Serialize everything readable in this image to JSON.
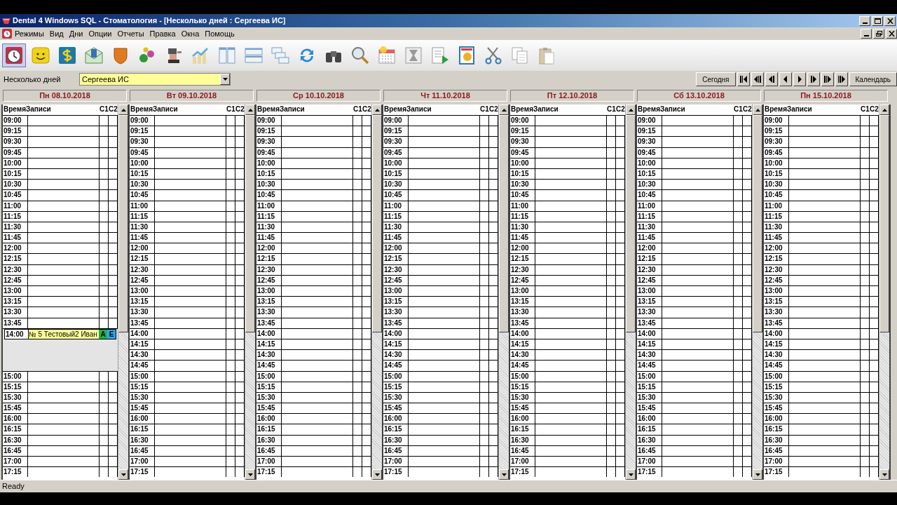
{
  "window": {
    "title": "Dental 4 Windows SQL - Стоматология - [Несколько дней : Сергеева ИС]"
  },
  "menu": [
    "Режимы",
    "Вид",
    "Дни",
    "Опции",
    "Отчеты",
    "Правка",
    "Окна",
    "Помощь"
  ],
  "toolbar": [
    {
      "selected": true
    },
    {
      "selected": false
    },
    {
      "selected": false
    },
    {
      "selected": false
    },
    {
      "selected": false
    },
    {
      "selected": false
    },
    {
      "selected": false
    },
    {
      "selected": false
    },
    {
      "selected": false
    },
    {
      "selected": false
    },
    {
      "selected": false
    },
    {
      "selected": false
    },
    {
      "selected": false
    },
    {
      "selected": false
    },
    {
      "selected": false
    },
    {
      "selected": false
    },
    {
      "selected": false
    },
    {
      "selected": false
    },
    {
      "selected": false
    },
    {
      "selected": false
    },
    {
      "selected": false
    }
  ],
  "filter": {
    "label": "Несколько дней",
    "doctor": "Сергеева ИС",
    "today_button": "Сегодня",
    "calendar_button": "Календарь"
  },
  "days": [
    {
      "title": "Пн 08.10.2018",
      "columns": [
        "ВремяЗаписи",
        "С1",
        "С2"
      ],
      "slots": [
        {
          "kind": "slot",
          "time": "09:00"
        },
        {
          "kind": "slot",
          "time": "09:15"
        },
        {
          "kind": "slot",
          "time": "09:30"
        },
        {
          "kind": "slot",
          "time": "09:45"
        },
        {
          "kind": "slot",
          "time": "10:00"
        },
        {
          "kind": "slot",
          "time": "10:15"
        },
        {
          "kind": "slot",
          "time": "10:30"
        },
        {
          "kind": "slot",
          "time": "10:45"
        },
        {
          "kind": "slot",
          "time": "11:00"
        },
        {
          "kind": "slot",
          "time": "11:15"
        },
        {
          "kind": "slot",
          "time": "11:30"
        },
        {
          "kind": "slot",
          "time": "11:45"
        },
        {
          "kind": "slot",
          "time": "12:00"
        },
        {
          "kind": "slot",
          "time": "12:15"
        },
        {
          "kind": "slot",
          "time": "12:30"
        },
        {
          "kind": "slot",
          "time": "12:45"
        },
        {
          "kind": "slot",
          "time": "13:00"
        },
        {
          "kind": "slot",
          "time": "13:15"
        },
        {
          "kind": "slot",
          "time": "13:30"
        },
        {
          "kind": "slot",
          "time": "13:45"
        },
        {
          "kind": "appointment",
          "time": "14:00",
          "text": "№ 5  Тестовый2 Иван",
          "marks": [
            {
              "text": "А",
              "color": "#22b04c"
            },
            {
              "text": "Е",
              "color": "#2aa8f0"
            }
          ]
        },
        {
          "kind": "slot",
          "time": "15:00"
        },
        {
          "kind": "slot",
          "time": "15:15"
        },
        {
          "kind": "slot",
          "time": "15:30"
        },
        {
          "kind": "slot",
          "time": "15:45"
        },
        {
          "kind": "slot",
          "time": "16:00"
        },
        {
          "kind": "slot",
          "time": "16:15"
        },
        {
          "kind": "slot",
          "time": "16:30"
        },
        {
          "kind": "slot",
          "time": "16:45"
        },
        {
          "kind": "slot",
          "time": "17:00"
        },
        {
          "kind": "slot",
          "time": "17:15"
        }
      ]
    },
    {
      "title": "Вт 09.10.2018",
      "columns": [
        "ВремяЗаписи",
        "С1",
        "С2"
      ],
      "slots": [
        {
          "kind": "slot",
          "time": "09:00"
        },
        {
          "kind": "slot",
          "time": "09:15"
        },
        {
          "kind": "slot",
          "time": "09:30"
        },
        {
          "kind": "slot",
          "time": "09:45"
        },
        {
          "kind": "slot",
          "time": "10:00"
        },
        {
          "kind": "slot",
          "time": "10:15"
        },
        {
          "kind": "slot",
          "time": "10:30"
        },
        {
          "kind": "slot",
          "time": "10:45"
        },
        {
          "kind": "slot",
          "time": "11:00"
        },
        {
          "kind": "slot",
          "time": "11:15"
        },
        {
          "kind": "slot",
          "time": "11:30"
        },
        {
          "kind": "slot",
          "time": "11:45"
        },
        {
          "kind": "slot",
          "time": "12:00"
        },
        {
          "kind": "slot",
          "time": "12:15"
        },
        {
          "kind": "slot",
          "time": "12:30"
        },
        {
          "kind": "slot",
          "time": "12:45"
        },
        {
          "kind": "slot",
          "time": "13:00"
        },
        {
          "kind": "slot",
          "time": "13:15"
        },
        {
          "kind": "slot",
          "time": "13:30"
        },
        {
          "kind": "slot",
          "time": "13:45"
        },
        {
          "kind": "slot",
          "time": "14:00"
        },
        {
          "kind": "slot",
          "time": "14:15"
        },
        {
          "kind": "slot",
          "time": "14:30"
        },
        {
          "kind": "slot",
          "time": "14:45"
        },
        {
          "kind": "slot",
          "time": "15:00"
        },
        {
          "kind": "slot",
          "time": "15:15"
        },
        {
          "kind": "slot",
          "time": "15:30"
        },
        {
          "kind": "slot",
          "time": "15:45"
        },
        {
          "kind": "slot",
          "time": "16:00"
        },
        {
          "kind": "slot",
          "time": "16:15"
        },
        {
          "kind": "slot",
          "time": "16:30"
        },
        {
          "kind": "slot",
          "time": "16:45"
        },
        {
          "kind": "slot",
          "time": "17:00"
        },
        {
          "kind": "slot",
          "time": "17:15"
        }
      ]
    },
    {
      "title": "Ср 10.10.2018",
      "columns": [
        "ВремяЗаписи",
        "С1",
        "С2"
      ],
      "slots": [
        {
          "kind": "slot",
          "time": "09:00"
        },
        {
          "kind": "slot",
          "time": "09:15"
        },
        {
          "kind": "slot",
          "time": "09:30"
        },
        {
          "kind": "slot",
          "time": "09:45"
        },
        {
          "kind": "slot",
          "time": "10:00"
        },
        {
          "kind": "slot",
          "time": "10:15"
        },
        {
          "kind": "slot",
          "time": "10:30"
        },
        {
          "kind": "slot",
          "time": "10:45"
        },
        {
          "kind": "slot",
          "time": "11:00"
        },
        {
          "kind": "slot",
          "time": "11:15"
        },
        {
          "kind": "slot",
          "time": "11:30"
        },
        {
          "kind": "slot",
          "time": "11:45"
        },
        {
          "kind": "slot",
          "time": "12:00"
        },
        {
          "kind": "slot",
          "time": "12:15"
        },
        {
          "kind": "slot",
          "time": "12:30"
        },
        {
          "kind": "slot",
          "time": "12:45"
        },
        {
          "kind": "slot",
          "time": "13:00"
        },
        {
          "kind": "slot",
          "time": "13:15"
        },
        {
          "kind": "slot",
          "time": "13:30"
        },
        {
          "kind": "slot",
          "time": "13:45"
        },
        {
          "kind": "slot",
          "time": "14:00"
        },
        {
          "kind": "slot",
          "time": "14:15"
        },
        {
          "kind": "slot",
          "time": "14:30"
        },
        {
          "kind": "slot",
          "time": "14:45"
        },
        {
          "kind": "slot",
          "time": "15:00"
        },
        {
          "kind": "slot",
          "time": "15:15"
        },
        {
          "kind": "slot",
          "time": "15:30"
        },
        {
          "kind": "slot",
          "time": "15:45"
        },
        {
          "kind": "slot",
          "time": "16:00"
        },
        {
          "kind": "slot",
          "time": "16:15"
        },
        {
          "kind": "slot",
          "time": "16:30"
        },
        {
          "kind": "slot",
          "time": "16:45"
        },
        {
          "kind": "slot",
          "time": "17:00"
        },
        {
          "kind": "slot",
          "time": "17:15"
        }
      ]
    },
    {
      "title": "Чт 11.10.2018",
      "columns": [
        "ВремяЗаписи",
        "С1",
        "С2"
      ],
      "slots": [
        {
          "kind": "slot",
          "time": "09:00"
        },
        {
          "kind": "slot",
          "time": "09:15"
        },
        {
          "kind": "slot",
          "time": "09:30"
        },
        {
          "kind": "slot",
          "time": "09:45"
        },
        {
          "kind": "slot",
          "time": "10:00"
        },
        {
          "kind": "slot",
          "time": "10:15"
        },
        {
          "kind": "slot",
          "time": "10:30"
        },
        {
          "kind": "slot",
          "time": "10:45"
        },
        {
          "kind": "slot",
          "time": "11:00"
        },
        {
          "kind": "slot",
          "time": "11:15"
        },
        {
          "kind": "slot",
          "time": "11:30"
        },
        {
          "kind": "slot",
          "time": "11:45"
        },
        {
          "kind": "slot",
          "time": "12:00"
        },
        {
          "kind": "slot",
          "time": "12:15"
        },
        {
          "kind": "slot",
          "time": "12:30"
        },
        {
          "kind": "slot",
          "time": "12:45"
        },
        {
          "kind": "slot",
          "time": "13:00"
        },
        {
          "kind": "slot",
          "time": "13:15"
        },
        {
          "kind": "slot",
          "time": "13:30"
        },
        {
          "kind": "slot",
          "time": "13:45"
        },
        {
          "kind": "slot",
          "time": "14:00"
        },
        {
          "kind": "slot",
          "time": "14:15"
        },
        {
          "kind": "slot",
          "time": "14:30"
        },
        {
          "kind": "slot",
          "time": "14:45"
        },
        {
          "kind": "slot",
          "time": "15:00"
        },
        {
          "kind": "slot",
          "time": "15:15"
        },
        {
          "kind": "slot",
          "time": "15:30"
        },
        {
          "kind": "slot",
          "time": "15:45"
        },
        {
          "kind": "slot",
          "time": "16:00"
        },
        {
          "kind": "slot",
          "time": "16:15"
        },
        {
          "kind": "slot",
          "time": "16:30"
        },
        {
          "kind": "slot",
          "time": "16:45"
        },
        {
          "kind": "slot",
          "time": "17:00"
        },
        {
          "kind": "slot",
          "time": "17:15"
        }
      ]
    },
    {
      "title": "Пт 12.10.2018",
      "columns": [
        "ВремяЗаписи",
        "С1",
        "С2"
      ],
      "slots": [
        {
          "kind": "slot",
          "time": "09:00"
        },
        {
          "kind": "slot",
          "time": "09:15"
        },
        {
          "kind": "slot",
          "time": "09:30"
        },
        {
          "kind": "slot",
          "time": "09:45"
        },
        {
          "kind": "slot",
          "time": "10:00"
        },
        {
          "kind": "slot",
          "time": "10:15"
        },
        {
          "kind": "slot",
          "time": "10:30"
        },
        {
          "kind": "slot",
          "time": "10:45"
        },
        {
          "kind": "slot",
          "time": "11:00"
        },
        {
          "kind": "slot",
          "time": "11:15"
        },
        {
          "kind": "slot",
          "time": "11:30"
        },
        {
          "kind": "slot",
          "time": "11:45"
        },
        {
          "kind": "slot",
          "time": "12:00"
        },
        {
          "kind": "slot",
          "time": "12:15"
        },
        {
          "kind": "slot",
          "time": "12:30"
        },
        {
          "kind": "slot",
          "time": "12:45"
        },
        {
          "kind": "slot",
          "time": "13:00"
        },
        {
          "kind": "slot",
          "time": "13:15"
        },
        {
          "kind": "slot",
          "time": "13:30"
        },
        {
          "kind": "slot",
          "time": "13:45"
        },
        {
          "kind": "slot",
          "time": "14:00"
        },
        {
          "kind": "slot",
          "time": "14:15"
        },
        {
          "kind": "slot",
          "time": "14:30"
        },
        {
          "kind": "slot",
          "time": "14:45"
        },
        {
          "kind": "slot",
          "time": "15:00"
        },
        {
          "kind": "slot",
          "time": "15:15"
        },
        {
          "kind": "slot",
          "time": "15:30"
        },
        {
          "kind": "slot",
          "time": "15:45"
        },
        {
          "kind": "slot",
          "time": "16:00"
        },
        {
          "kind": "slot",
          "time": "16:15"
        },
        {
          "kind": "slot",
          "time": "16:30"
        },
        {
          "kind": "slot",
          "time": "16:45"
        },
        {
          "kind": "slot",
          "time": "17:00"
        },
        {
          "kind": "slot",
          "time": "17:15"
        }
      ]
    },
    {
      "title": "Сб 13.10.2018",
      "columns": [
        "ВремяЗаписи",
        "С1",
        "С2"
      ],
      "slots": [
        {
          "kind": "slot",
          "time": "09:00"
        },
        {
          "kind": "slot",
          "time": "09:15"
        },
        {
          "kind": "slot",
          "time": "09:30"
        },
        {
          "kind": "slot",
          "time": "09:45"
        },
        {
          "kind": "slot",
          "time": "10:00"
        },
        {
          "kind": "slot",
          "time": "10:15"
        },
        {
          "kind": "slot",
          "time": "10:30"
        },
        {
          "kind": "slot",
          "time": "10:45"
        },
        {
          "kind": "slot",
          "time": "11:00"
        },
        {
          "kind": "slot",
          "time": "11:15"
        },
        {
          "kind": "slot",
          "time": "11:30"
        },
        {
          "kind": "slot",
          "time": "11:45"
        },
        {
          "kind": "slot",
          "time": "12:00"
        },
        {
          "kind": "slot",
          "time": "12:15"
        },
        {
          "kind": "slot",
          "time": "12:30"
        },
        {
          "kind": "slot",
          "time": "12:45"
        },
        {
          "kind": "slot",
          "time": "13:00"
        },
        {
          "kind": "slot",
          "time": "13:15"
        },
        {
          "kind": "slot",
          "time": "13:30"
        },
        {
          "kind": "slot",
          "time": "13:45"
        },
        {
          "kind": "slot",
          "time": "14:00"
        },
        {
          "kind": "slot",
          "time": "14:15"
        },
        {
          "kind": "slot",
          "time": "14:30"
        },
        {
          "kind": "slot",
          "time": "14:45"
        },
        {
          "kind": "slot",
          "time": "15:00"
        },
        {
          "kind": "slot",
          "time": "15:15"
        },
        {
          "kind": "slot",
          "time": "15:30"
        },
        {
          "kind": "slot",
          "time": "15:45"
        },
        {
          "kind": "slot",
          "time": "16:00"
        },
        {
          "kind": "slot",
          "time": "16:15"
        },
        {
          "kind": "slot",
          "time": "16:30"
        },
        {
          "kind": "slot",
          "time": "16:45"
        },
        {
          "kind": "slot",
          "time": "17:00"
        },
        {
          "kind": "slot",
          "time": "17:15"
        }
      ]
    },
    {
      "title": "Пн 15.10.2018",
      "columns": [
        "ВремяЗаписи",
        "С1",
        "С2"
      ],
      "slots": [
        {
          "kind": "slot",
          "time": "09:00"
        },
        {
          "kind": "slot",
          "time": "09:15"
        },
        {
          "kind": "slot",
          "time": "09:30"
        },
        {
          "kind": "slot",
          "time": "09:45"
        },
        {
          "kind": "slot",
          "time": "10:00"
        },
        {
          "kind": "slot",
          "time": "10:15"
        },
        {
          "kind": "slot",
          "time": "10:30"
        },
        {
          "kind": "slot",
          "time": "10:45"
        },
        {
          "kind": "slot",
          "time": "11:00"
        },
        {
          "kind": "slot",
          "time": "11:15"
        },
        {
          "kind": "slot",
          "time": "11:30"
        },
        {
          "kind": "slot",
          "time": "11:45"
        },
        {
          "kind": "slot",
          "time": "12:00"
        },
        {
          "kind": "slot",
          "time": "12:15"
        },
        {
          "kind": "slot",
          "time": "12:30"
        },
        {
          "kind": "slot",
          "time": "12:45"
        },
        {
          "kind": "slot",
          "time": "13:00"
        },
        {
          "kind": "slot",
          "time": "13:15"
        },
        {
          "kind": "slot",
          "time": "13:30"
        },
        {
          "kind": "slot",
          "time": "13:45"
        },
        {
          "kind": "slot",
          "time": "14:00"
        },
        {
          "kind": "slot",
          "time": "14:15"
        },
        {
          "kind": "slot",
          "time": "14:30"
        },
        {
          "kind": "slot",
          "time": "14:45"
        },
        {
          "kind": "slot",
          "time": "15:00"
        },
        {
          "kind": "slot",
          "time": "15:15"
        },
        {
          "kind": "slot",
          "time": "15:30"
        },
        {
          "kind": "slot",
          "time": "15:45"
        },
        {
          "kind": "slot",
          "time": "16:00"
        },
        {
          "kind": "slot",
          "time": "16:15"
        },
        {
          "kind": "slot",
          "time": "16:30"
        },
        {
          "kind": "slot",
          "time": "16:45"
        },
        {
          "kind": "slot",
          "time": "17:00"
        },
        {
          "kind": "slot",
          "time": "17:15"
        }
      ]
    }
  ],
  "status_bar": "Ready"
}
